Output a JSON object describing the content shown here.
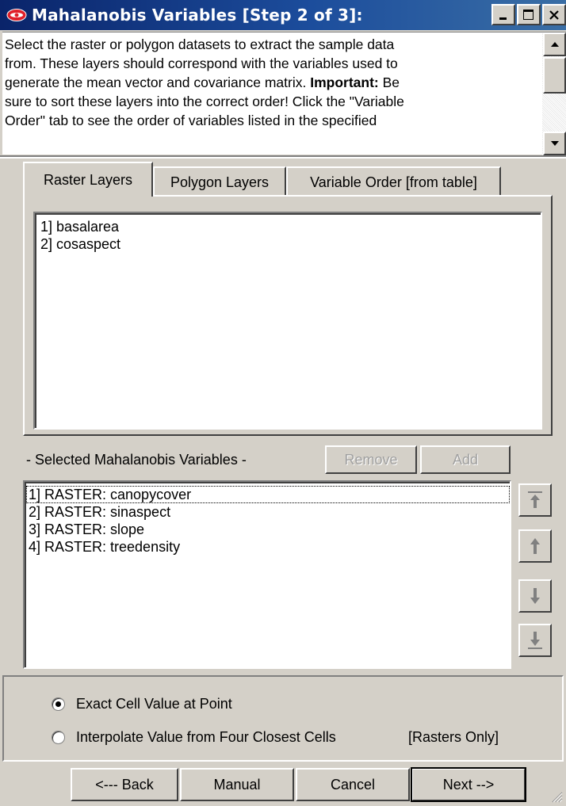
{
  "window": {
    "title": "Mahalanobis Variables [Step 2 of 3]:"
  },
  "description": {
    "lines": [
      "Select the raster or polygon datasets to extract the sample data",
      "from.  These layers should correspond with the variables used to",
      "generate the mean vector and covariance matrix. ",
      "sure to sort these layers into the correct order!  Click the \"Variable",
      "Order\" tab to see the order of variables listed in the specified"
    ],
    "important_label": "Important:",
    "line3_tail": " Be"
  },
  "tabs": [
    {
      "label": "Raster Layers",
      "active": true
    },
    {
      "label": "Polygon Layers",
      "active": false
    },
    {
      "label": "Variable Order [from table]",
      "active": false
    }
  ],
  "raster_layers": [
    "1] basalarea",
    "2] cosaspect"
  ],
  "selected_section": {
    "label": "- Selected Mahalanobis Variables -",
    "remove_label": "Remove",
    "add_label": "Add",
    "items": [
      "1] RASTER: canopycover",
      "2] RASTER: sinaspect",
      "3] RASTER: slope",
      "4] RASTER: treedensity"
    ]
  },
  "options": {
    "exact_label": "Exact Cell Value at Point",
    "interpolate_label": "Interpolate Value from Four Closest Cells",
    "rasters_only_label": "[Rasters Only]",
    "selected": "exact"
  },
  "buttons": {
    "back": "<--- Back",
    "manual": "Manual",
    "cancel": "Cancel",
    "next": "Next -->"
  },
  "colors": {
    "titlebar_start": "#0a246a",
    "titlebar_end": "#3a6ea5",
    "dialog_face": "#d4d0c8",
    "app_icon": "#e0202a"
  }
}
